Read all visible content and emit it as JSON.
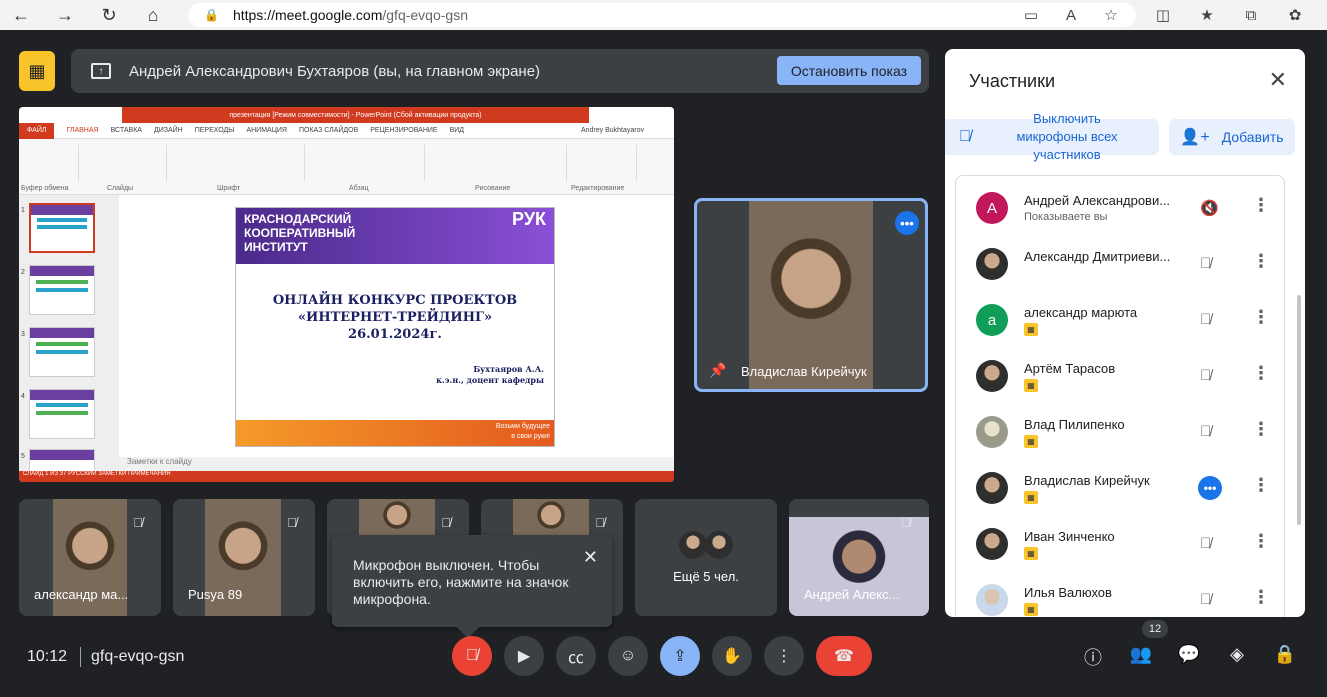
{
  "browser": {
    "url_host": "https://meet.google.com",
    "url_path": "/gfq-evqo-gsn"
  },
  "presenting": {
    "text": "Андрей Александрович Бухтаяров (вы, на главном экране)",
    "stop_label": "Остановить показ"
  },
  "ppt": {
    "window_title": "презентация [Режим совместимости] - PowerPoint (Сбой активации продукта)",
    "file_tab": "ФАЙЛ",
    "tabs": [
      "ГЛАВНАЯ",
      "ВСТАВКА",
      "ДИЗАЙН",
      "ПЕРЕХОДЫ",
      "АНИМАЦИЯ",
      "ПОКАЗ СЛАЙДОВ",
      "РЕЦЕНЗИРОВАНИЕ",
      "ВИД"
    ],
    "user": "Andrey Bukhtayarov",
    "groups": [
      "Буфер обмена",
      "Слайды",
      "Шрифт",
      "Абзац",
      "Рисование",
      "Редактирование"
    ],
    "slide_numbers": [
      "1",
      "2",
      "3",
      "4",
      "5"
    ],
    "slide": {
      "org_line1": "КРАСНОДАРСКИЙ",
      "org_line2": "КООПЕРАТИВНЫЙ",
      "org_line3": "ИНСТИТУТ",
      "logo": "РУК",
      "title1": "ОНЛАЙН КОНКУРС ПРОЕКТОВ",
      "title2": "«ИНТЕРНЕТ-ТРЕЙДИНГ»",
      "date": "26.01.2024г.",
      "author": "Бухтаяров А.А.",
      "author_title": "к.э.н., доцент кафедры",
      "footer1": "Возьми будущее",
      "footer2": "в свои руки!"
    },
    "notes": "Заметки к слайду",
    "status": "СЛАЙД 1 ИЗ 37   РУССКИЙ        ЗАМЕТКИ   ПРИМЕЧАНИЯ"
  },
  "spotlight": {
    "name": "Владислав Кирейчук"
  },
  "tiles": [
    {
      "name": "александр ма..."
    },
    {
      "name": "Pusya 89"
    },
    {
      "name": ""
    },
    {
      "name": ""
    },
    {
      "name": "Ещё 5 чел."
    },
    {
      "name": "Андрей Алекс..."
    }
  ],
  "toast": {
    "message": "Микрофон выключен. Чтобы включить его, нажмите на значок микрофона."
  },
  "sidebar": {
    "title": "Участники",
    "mute_all": "Выключить микрофоны всех участников",
    "add": "Добавить",
    "participants": [
      {
        "name": "Андрей Александрови...",
        "sub": "Показываете вы",
        "initial": "А",
        "color": "#c2185b"
      },
      {
        "name": "Александр Дмитриеви...",
        "sub": "",
        "initial": "",
        "color": ""
      },
      {
        "name": "александр марюта",
        "sub": "",
        "initial": "а",
        "color": "#0f9d58"
      },
      {
        "name": "Артём Тарасов",
        "sub": "",
        "initial": "",
        "color": ""
      },
      {
        "name": "Влад Пилипенко",
        "sub": "",
        "initial": "",
        "color": ""
      },
      {
        "name": "Владислав Кирейчук",
        "sub": "",
        "initial": "",
        "color": ""
      },
      {
        "name": "Иван Зинченко",
        "sub": "",
        "initial": "",
        "color": ""
      },
      {
        "name": "Илья Валюхов",
        "sub": "",
        "initial": "",
        "color": ""
      }
    ]
  },
  "bottom": {
    "time": "10:12",
    "code": "gfq-evqo-gsn",
    "participant_count": "12"
  },
  "colors": {
    "accent": "#8ab4f8",
    "danger": "#ea4335",
    "recording": "#f9c42a"
  }
}
